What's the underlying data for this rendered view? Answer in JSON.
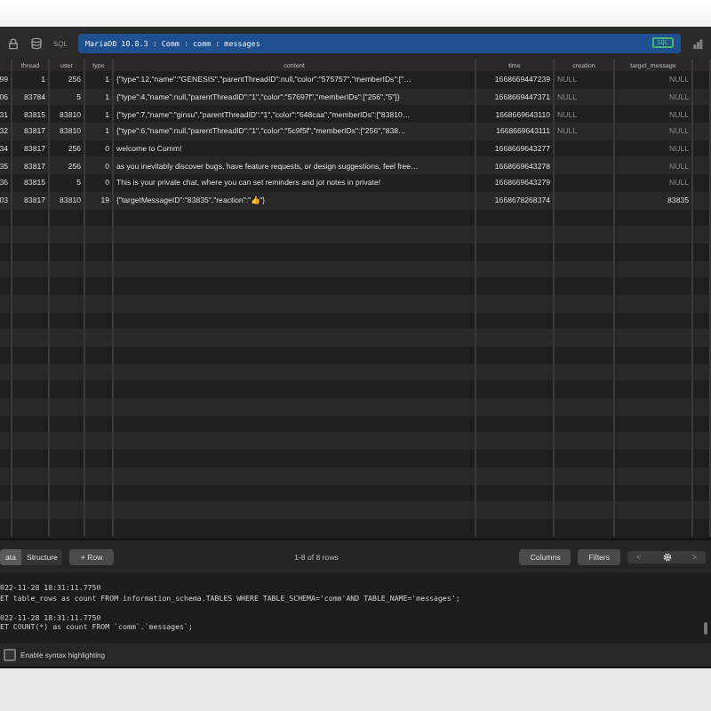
{
  "toolbar": {
    "sql_label": "SQL",
    "address": "MariaDB 10.8.3 : Comm : comm : messages",
    "badge": "SQL"
  },
  "table": {
    "columns": [
      "",
      "thread",
      "user",
      "type",
      "content",
      "time",
      "creation",
      "target_message"
    ],
    "rows": [
      [
        "99",
        "1",
        "256",
        "1",
        "{\"type\":12,\"name\":\"GENESIS\",\"parentThreadID\":null,\"color\":\"575757\",\"memberIDs\":[\"…",
        "1668669447239",
        "NULL",
        "NULL"
      ],
      [
        "06",
        "83784",
        "5",
        "1",
        "{\"type\":4,\"name\":null,\"parentThreadID\":\"1\",\"color\":\"57697f\",\"memberIDs\":[\"256\",\"5\"]}",
        "1668669447371",
        "NULL",
        "NULL"
      ],
      [
        "31",
        "83815",
        "83810",
        "1",
        "{\"type\":7,\"name\":\"ginsu\",\"parentThreadID\":\"1\",\"color\":\"648caa\",\"memberIDs\":[\"83810…",
        "1668669643110",
        "NULL",
        "NULL"
      ],
      [
        "32",
        "83817",
        "83810",
        "1",
        "{\"type\":6,\"name\":null,\"parentThreadID\":\"1\",\"color\":\"5c9f5f\",\"memberIDs\":[\"256\",\"838…",
        "1668669643111",
        "NULL",
        "NULL"
      ],
      [
        "34",
        "83817",
        "256",
        "0",
        "welcome to Comm!",
        "1668669643277",
        "",
        "NULL"
      ],
      [
        "35",
        "83817",
        "256",
        "0",
        "as you inevitably discover bugs, have feature requests, or design suggestions, feel free…",
        "1668669643278",
        "",
        "NULL"
      ],
      [
        "36",
        "83815",
        "5",
        "0",
        "This is your private chat, where you can set reminders and jot notes in private!",
        "1668669643279",
        "",
        "NULL"
      ],
      [
        "03",
        "83817",
        "83810",
        "19",
        "{\"targetMessageID\":\"83835\",\"reaction\":\"👍\"}",
        "1668678268374",
        "",
        "83835"
      ]
    ]
  },
  "bottom_bar": {
    "tabs": [
      {
        "label": "ata",
        "selected": true
      },
      {
        "label": "Structure",
        "selected": false
      }
    ],
    "add_button": "+ Row",
    "count": "1-8 of 8 rows",
    "buttons": [
      "Columns",
      "Filters"
    ],
    "prev": "<",
    "next": ">"
  },
  "log": [
    {
      "time": "022-11-28 18:31:11.7750",
      "query": "ET table_rows as count FROM information_schema.TABLES WHERE TABLE_SCHEMA='comm'AND TABLE_NAME='messages';"
    },
    {
      "time": "022-11-28 18:31:11.7750",
      "query": "ET COUNT(*) as count FROM `comm`.`messages`;"
    }
  ],
  "syntax_highlighting": {
    "label": "Enable syntax highlighting",
    "checked": false
  }
}
